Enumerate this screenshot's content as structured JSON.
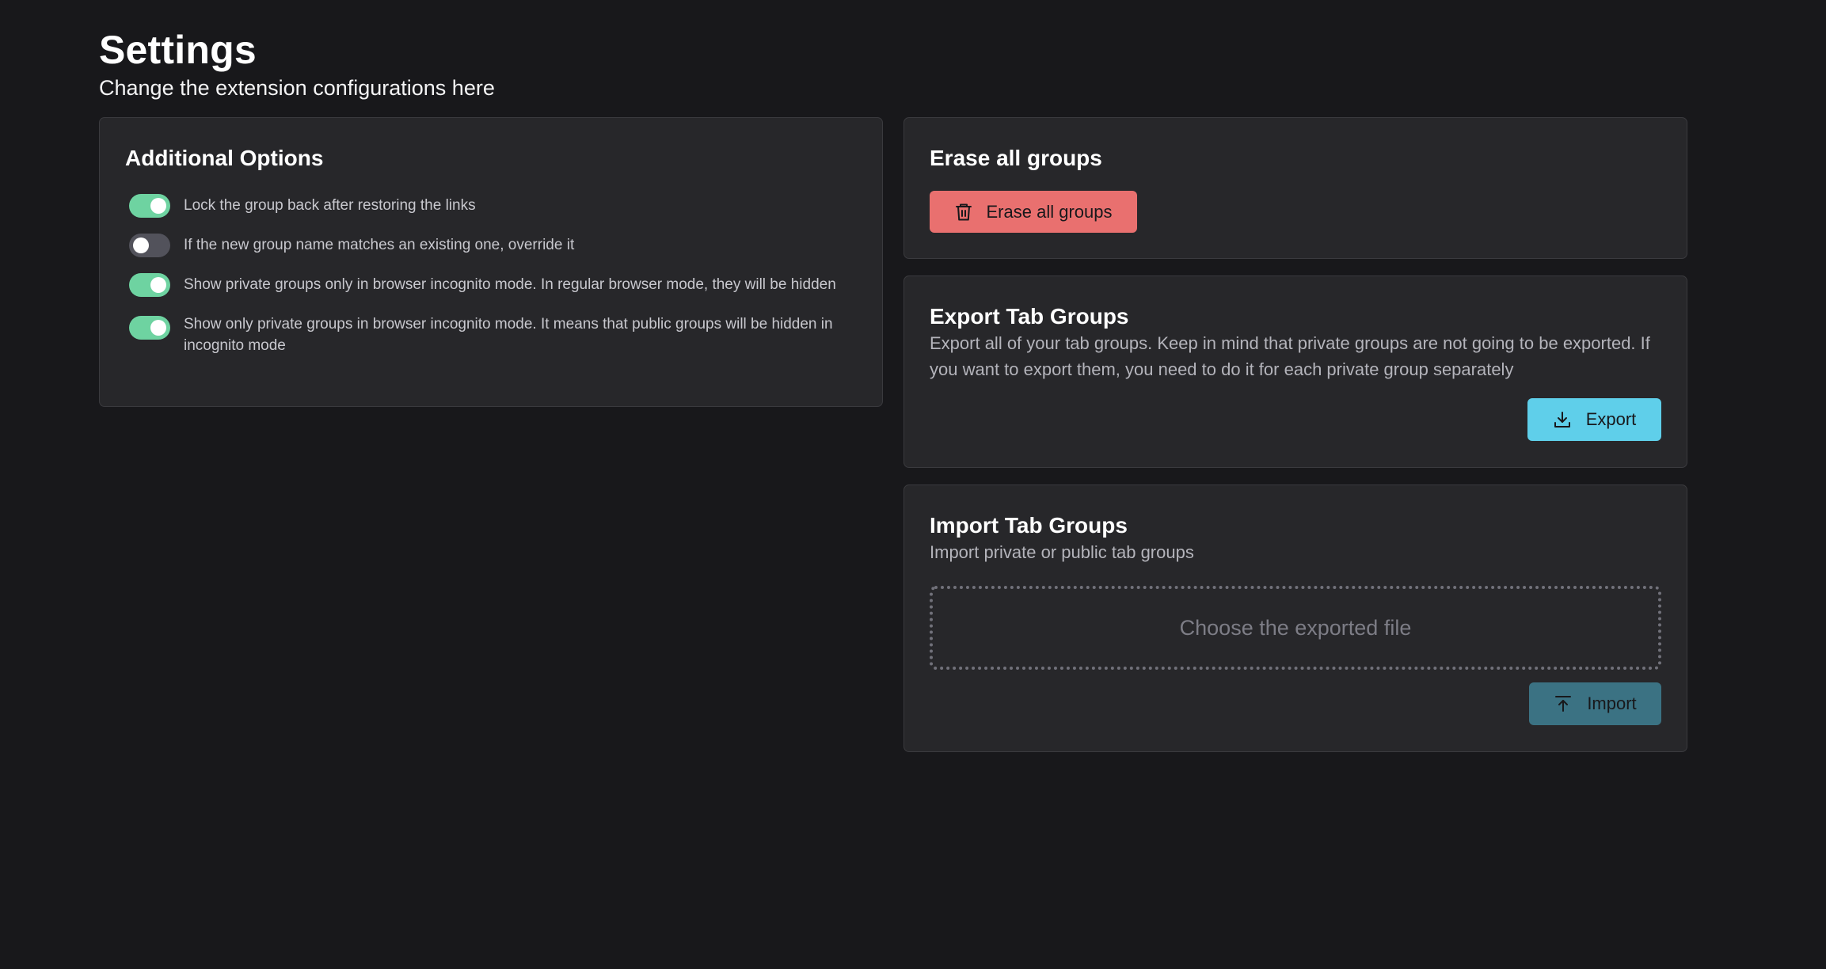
{
  "header": {
    "title": "Settings",
    "subtitle": "Change the extension configurations here"
  },
  "additional_options": {
    "title": "Additional Options",
    "options": [
      {
        "label": "Lock the group back after restoring the links",
        "enabled": true
      },
      {
        "label": "If the new group name matches an existing one, override it",
        "enabled": false
      },
      {
        "label": "Show private groups only in browser incognito mode. In regular browser mode, they will be hidden",
        "enabled": true
      },
      {
        "label": "Show only private groups in browser incognito mode. It means that public groups will be hidden in incognito mode",
        "enabled": true
      }
    ]
  },
  "erase": {
    "title": "Erase all groups",
    "button_label": "Erase all groups",
    "button_icon": "trash-icon",
    "button_color": "#e9706f"
  },
  "export": {
    "title": "Export Tab Groups",
    "description": "Export all of your tab groups. Keep in mind that private groups are not going to be exported. If you want to export them, you need to do it for each private group separately",
    "button_label": "Export",
    "button_icon": "download-icon",
    "button_color": "#5fcfea"
  },
  "import": {
    "title": "Import Tab Groups",
    "description": "Import private or public tab groups",
    "dropzone_label": "Choose the exported file",
    "button_label": "Import",
    "button_icon": "upload-icon",
    "button_color": "#3b7283"
  },
  "colors": {
    "background": "#18181b",
    "card": "#27272a",
    "toggle_on": "#6ed3a1",
    "toggle_off": "#52525b"
  }
}
